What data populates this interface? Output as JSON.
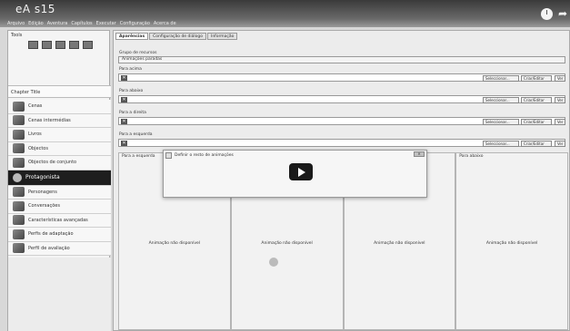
{
  "video": {
    "title": "eA s15"
  },
  "menubar": [
    "Arquivo",
    "Edição",
    "Aventura",
    "Capítulos",
    "Executar",
    "Configuração",
    "Acerca de"
  ],
  "left": {
    "tools_label": "Tools",
    "chapter_title": "Chapter Title",
    "items": [
      {
        "label": "Cenas"
      },
      {
        "label": "Cenas intermédias"
      },
      {
        "label": "Livros"
      },
      {
        "label": "Objectos"
      },
      {
        "label": "Objectos de conjunto"
      },
      {
        "label": "Protagonista"
      },
      {
        "label": "Personagens"
      },
      {
        "label": "Conversações"
      },
      {
        "label": "Características avançadas"
      },
      {
        "label": "Perfis de adaptação"
      },
      {
        "label": "Perfil de avaliação"
      }
    ]
  },
  "tabs": [
    "Aparências",
    "Configuração de diálogo",
    "Informação"
  ],
  "group": {
    "label": "Grupo de recursos",
    "value": "Animações paradas"
  },
  "sections": [
    {
      "label": "Para acima"
    },
    {
      "label": "Para abaixo"
    },
    {
      "label": "Para a direita"
    },
    {
      "label": "Para a esquerda"
    }
  ],
  "buttons": {
    "select": "Seleccionar...",
    "create": "Criar/Editar",
    "view": "Ver"
  },
  "previews": [
    {
      "title": "Para a esquerda",
      "text": "Animação não disponível"
    },
    {
      "title": "Para a direita",
      "text": "Animação não disponível"
    },
    {
      "title": "Para acima",
      "text": "Animação não disponível"
    },
    {
      "title": "Para abaixo",
      "text": "Animação não disponível"
    }
  ],
  "dialog": {
    "title": "Definir o resto de animações"
  }
}
